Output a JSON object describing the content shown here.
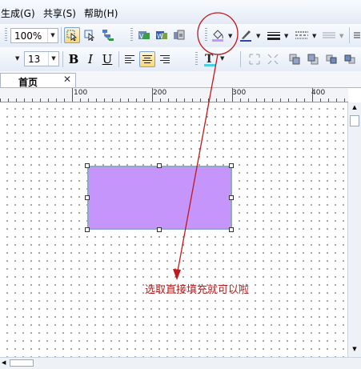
{
  "menu": {
    "generate": "生成(G)",
    "share": "共享(S)",
    "help": "帮助(H)"
  },
  "toolbar": {
    "zoom_value": "100%",
    "font_size_value": "13"
  },
  "tab": {
    "label": "首页"
  },
  "ruler": {
    "labels": [
      "100",
      "200",
      "300",
      "400"
    ]
  },
  "annotation": {
    "text": "选取直接填充就可以啦"
  },
  "colors": {
    "shape_fill": "#c595fb",
    "annotation_red": "#c0181b",
    "font_color_underline": "#49d0e3"
  },
  "icons": [
    "pointer-icon",
    "connector-icon",
    "fill-color-icon",
    "line-color-icon",
    "line-weight-icon",
    "line-style-icon",
    "bold-icon",
    "italic-icon",
    "underline-icon",
    "align-left-icon",
    "align-center-icon",
    "align-right-icon",
    "font-color-icon"
  ]
}
